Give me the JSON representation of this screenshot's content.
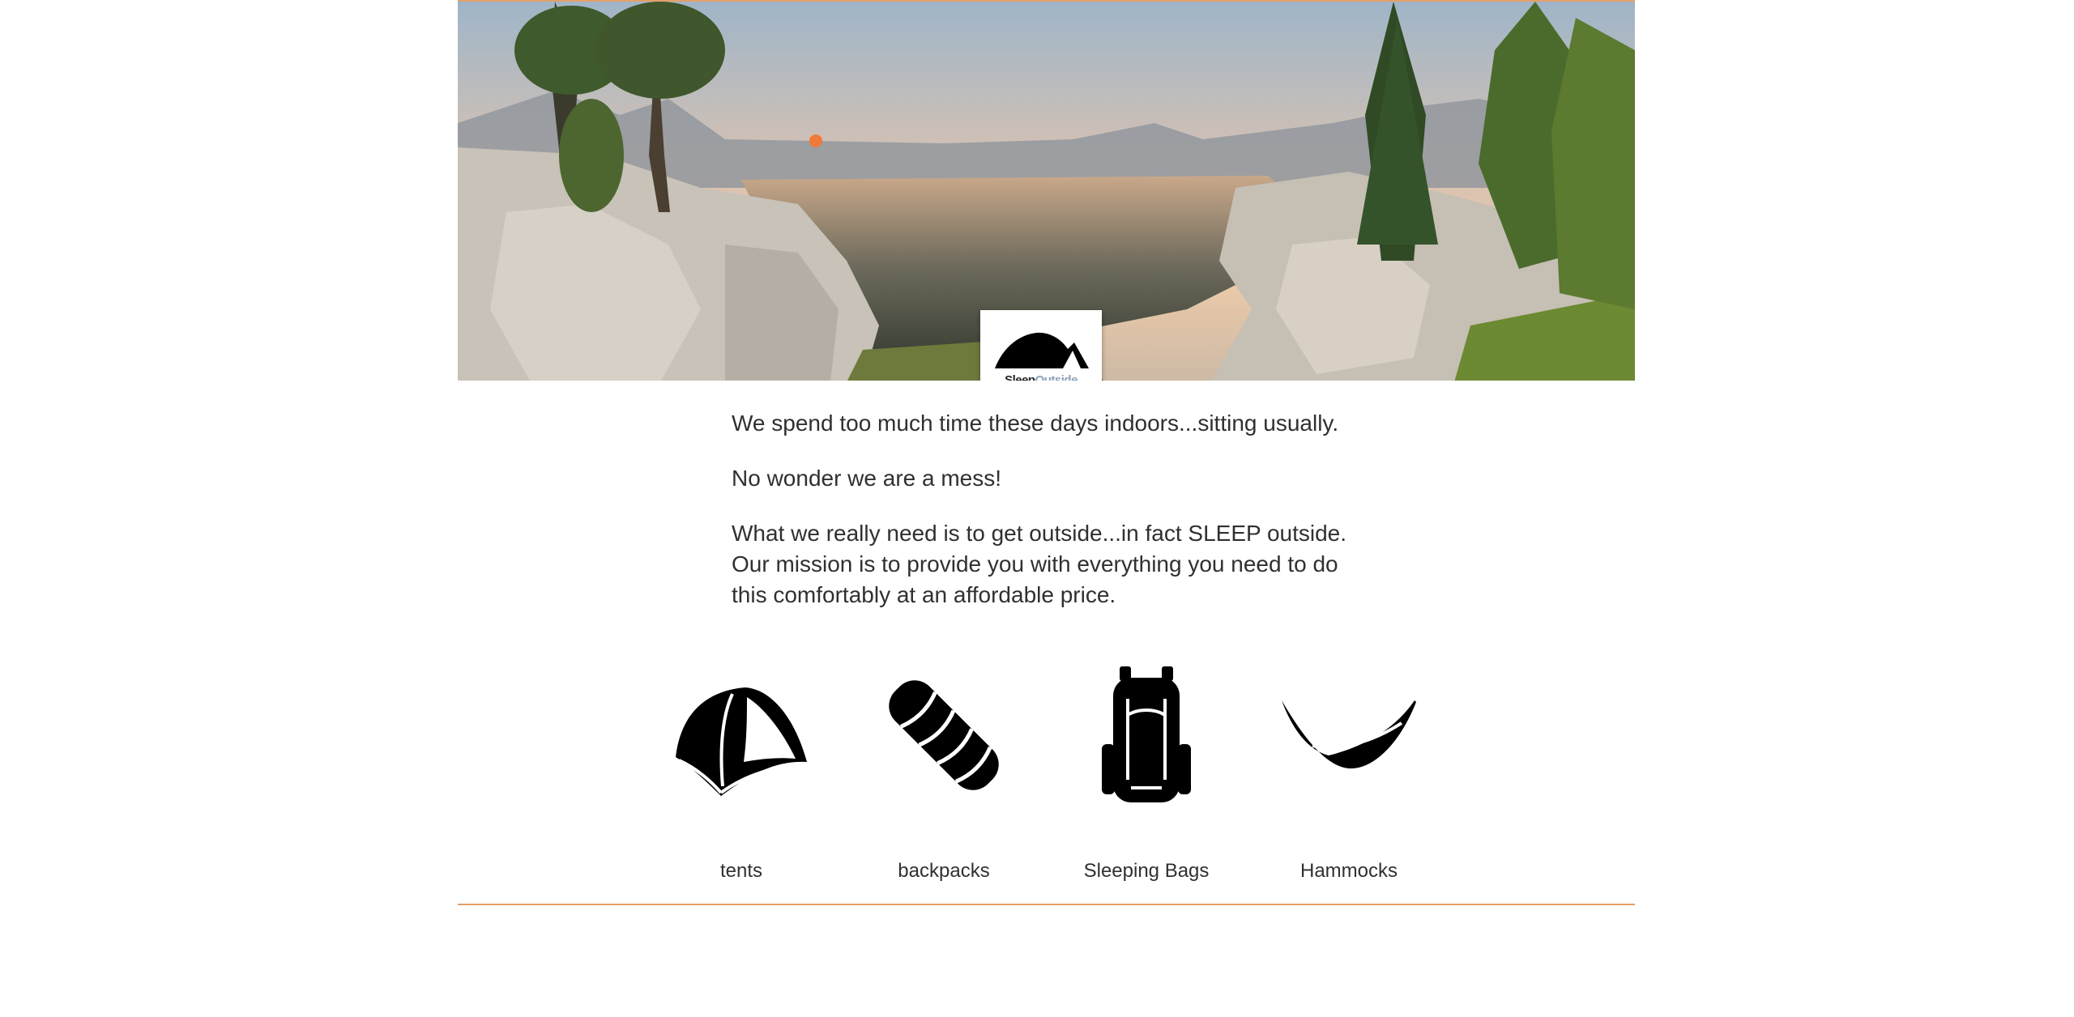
{
  "brand": {
    "name_part1": "Sleep",
    "name_part2": "Outside",
    "accent_color": "#e3a06a",
    "secondary_color": "#8aa1b8"
  },
  "hero": {
    "image": "mountain-lake-sunset-photo"
  },
  "mission": {
    "paragraphs": [
      "We spend too much time these days indoors...sitting usually.",
      "No wonder we are a mess!",
      "What we really need is to get outside...in fact SLEEP outside. Our mission is to provide you with everything you need to do this comfortably at an affordable price."
    ]
  },
  "categories": [
    {
      "label": "tents",
      "icon": "tent-icon"
    },
    {
      "label": "backpacks",
      "icon": "sleeping-bag-icon"
    },
    {
      "label": "Sleeping Bags",
      "icon": "backpack-icon"
    },
    {
      "label": "Hammocks",
      "icon": "hammock-icon"
    }
  ]
}
